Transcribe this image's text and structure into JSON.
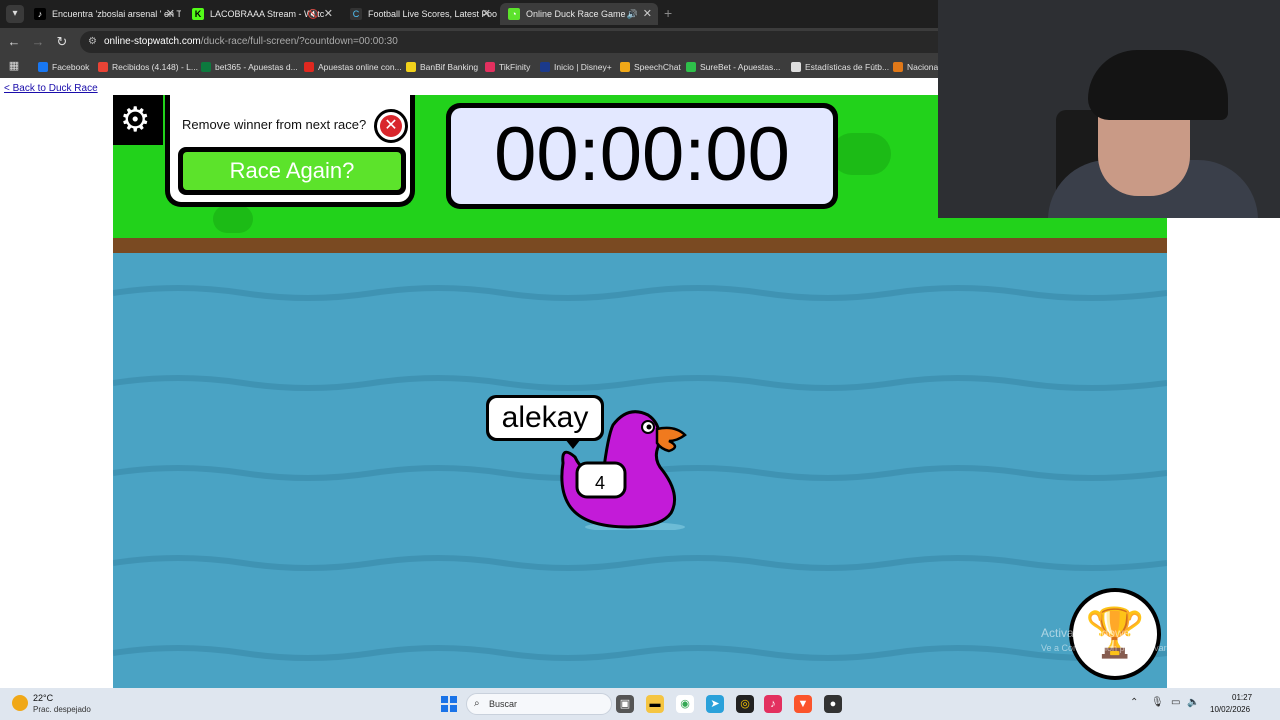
{
  "browser": {
    "tabs": [
      {
        "label": "Encuentra 'zboslai arsenal ' en T",
        "favicon": "tiktok-icon",
        "active": false
      },
      {
        "label": "LACOBRAAA Stream - Watc",
        "favicon": "kick-icon",
        "active": false
      },
      {
        "label": "Football Live Scores, Latest Foo",
        "favicon": "football-icon",
        "active": false
      },
      {
        "label": "Online Duck Race Game",
        "favicon": "stopwatch-icon",
        "active": true
      }
    ],
    "url_host": "online-stopwatch.com",
    "url_path": "/duck-race/full-screen/?countdown=00:00:30",
    "bookmarks": [
      {
        "label": "Facebook",
        "color": "#1877f2"
      },
      {
        "label": "Recibidos (4.148) - L...",
        "color": "#ea4335"
      },
      {
        "label": "bet365 - Apuestas d...",
        "color": "#0d7a3e"
      },
      {
        "label": "Apuestas online con...",
        "color": "#e0281f"
      },
      {
        "label": "BanBif Banking",
        "color": "#f2d21b"
      },
      {
        "label": "TikFinity",
        "color": "#e3305f"
      },
      {
        "label": "Inicio | Disney+",
        "color": "#1b3a8c"
      },
      {
        "label": "SpeechChat",
        "color": "#f0a818"
      },
      {
        "label": "SureBet - Apuestas...",
        "color": "#2ec04a"
      },
      {
        "label": "Estadísticas de Fútb...",
        "color": "#dddddd"
      },
      {
        "label": "Nacional",
        "color": "#e07818"
      }
    ]
  },
  "page": {
    "back_link": "< Back to Duck Race",
    "remove_winner_label": "Remove winner from next race?",
    "race_again_label": "Race Again?",
    "timer": "00:00:00",
    "duck": {
      "name": "alekay",
      "number": "4",
      "color": "#c31bd8"
    }
  },
  "overlay": {
    "watermark_title": "Activar Windows",
    "watermark_sub": "Ve a Configuración para activar Windows."
  },
  "taskbar": {
    "temperature": "22°C",
    "condition": "Prac. despejado",
    "search_placeholder": "Buscar",
    "time": "01:27",
    "date": "10/02/2026"
  },
  "colors": {
    "grass": "#22d21b",
    "water": "#4aa3c4",
    "race_again_button": "#5ce32b",
    "timer_bg": "#e3e8ff",
    "remove_button": "#d9262c"
  }
}
